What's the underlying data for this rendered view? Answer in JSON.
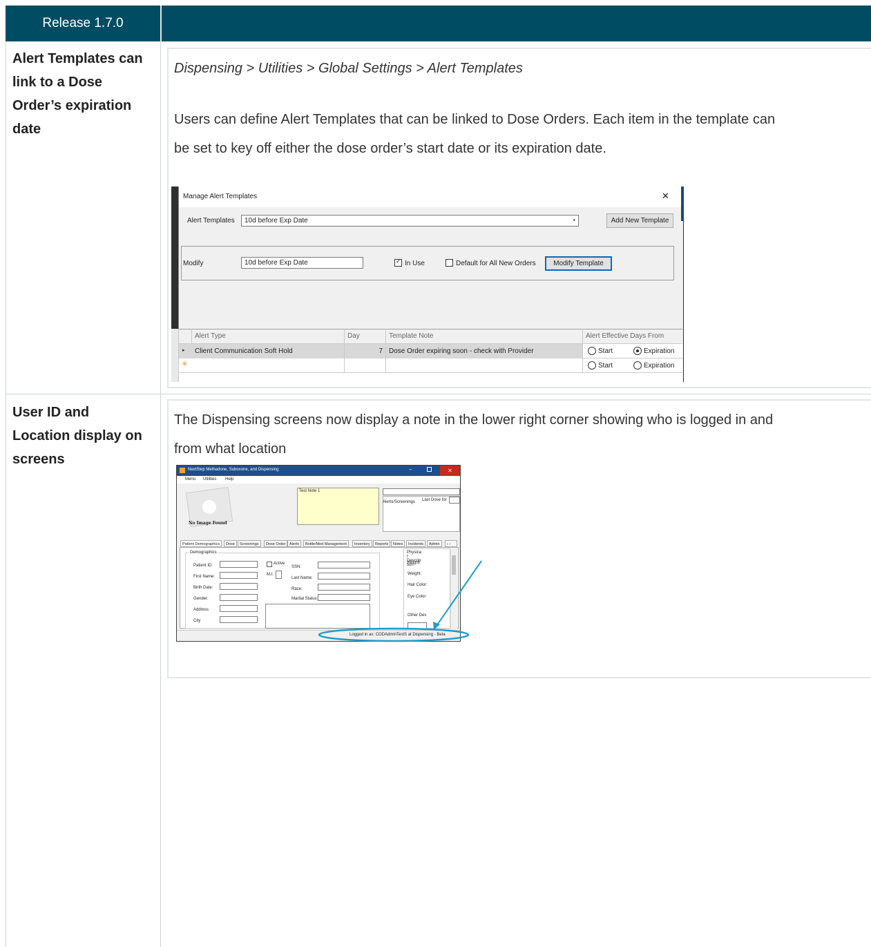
{
  "release": {
    "label": "Release 1.7.0"
  },
  "rows": [
    {
      "title": "Alert Templates can link to a Dose Order’s expiration date",
      "title_lines": [
        "Alert Templates can",
        "link to a Dose",
        "Order’s expiration",
        "date"
      ],
      "path": "Dispensing > Utilities > Global Settings > Alert Templates",
      "description_lines": [
        "Users can define Alert Templates that can be linked to Dose Orders.  Each item in the template can",
        "be set to key off either the dose order’s start date or its expiration date."
      ]
    },
    {
      "title_lines": [
        "User ID and",
        "Location display on",
        "screens"
      ],
      "description_lines": [
        "The Dispensing screens now display a note in the lower right corner showing who is logged in and",
        "from what location"
      ]
    }
  ],
  "alert_dialog": {
    "title": "Manage Alert Templates",
    "close_glyph": "✕",
    "templates_label": "Alert Templates",
    "templates_value": "10d before Exp Date",
    "add_button": "Add New Template",
    "modify_label": "Modify",
    "modify_value": "10d before Exp Date",
    "in_use_label": "In Use",
    "in_use_checked": true,
    "default_label": "Default for All New Orders",
    "default_checked": false,
    "modify_button": "Modify Template",
    "grid": {
      "columns": [
        "Alert Type",
        "Day",
        "Template Note",
        "Alert Effective Days From"
      ],
      "rows": [
        {
          "alert_type": "Client Communication Soft Hold",
          "day": "7",
          "note": "Dose Order expiring soon - check with Provider",
          "start": "Start",
          "expiration": "Expiration",
          "selected": "Expiration"
        },
        {
          "alert_type": "",
          "day": "",
          "note": "",
          "start": "Start",
          "expiration": "Expiration",
          "selected": ""
        }
      ]
    }
  },
  "nextstep_window": {
    "title": "NextStep Methadone, Suboxone, and Dispensing",
    "menu": [
      "Menu",
      "Utilities",
      "Help"
    ],
    "no_image": "No Image Found",
    "note_text": "Test Note 1",
    "alerts_label": "Alerts/Screenings",
    "last_dose_label": "Last Dose for",
    "tabs": [
      "Patient Demographics",
      "Dose",
      "Screenings",
      "Dose Order",
      "Alerts",
      "Bottle/Med Management",
      "Inventory",
      "Reports",
      "Notes",
      "Incidents",
      "Admin"
    ],
    "demographics_group": "Demographics",
    "fields_left": [
      "Patient ID:",
      "First Name:",
      "Birth Date:",
      "Gender:",
      "Address",
      "City"
    ],
    "active_label": "Active",
    "mi_label": "M.I.",
    "fields_right": [
      "SSN:",
      "Last Name:",
      "Race:",
      "Marital Status:"
    ],
    "physical_labels": [
      "Physica",
      "l",
      "Descrip",
      "tion",
      "Height:",
      "Weight:",
      "Hair Color:",
      "Eye Color:",
      "Other Des"
    ],
    "status_text": "Logged in as: CODAdminTestS at Dispensing - Beta"
  },
  "colors": {
    "header": "#004d63",
    "annotation": "#1a9ec9"
  }
}
